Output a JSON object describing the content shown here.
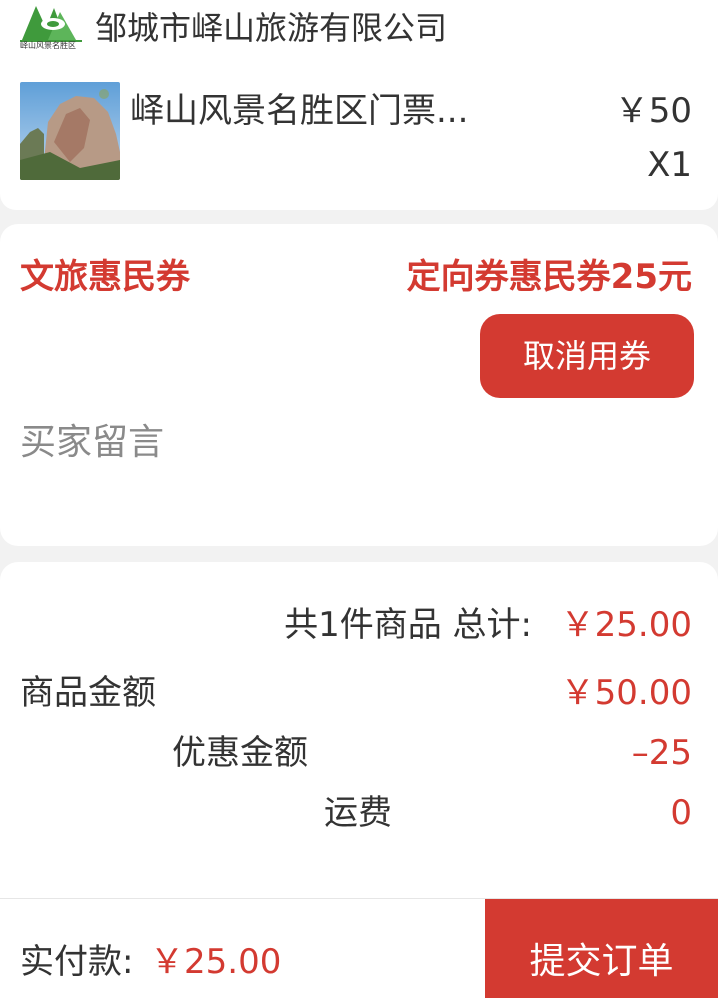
{
  "shop": {
    "name": "邹城市峄山旅游有限公司",
    "logo_caption": "峄山风景名胜区",
    "logo_icon": "mountain-logo-icon"
  },
  "product": {
    "title": "峄山风景名胜区门票...",
    "price": "￥50",
    "quantity": "X1",
    "image_icon": "scenic-rock-image"
  },
  "coupon": {
    "type": "文旅惠民券",
    "description": "定向券惠民券25元",
    "cancel_label": "取消用券"
  },
  "message": {
    "placeholder": "买家留言"
  },
  "summary": {
    "count_text": "共1件商品 总计:",
    "total": "￥25.00",
    "goods_label": "商品金额",
    "goods_value": "￥50.00",
    "discount_label": "优惠金额",
    "discount_value": "–25",
    "shipping_label": "运费",
    "shipping_value": "0"
  },
  "footer": {
    "pay_label": "实付款:",
    "pay_amount": "￥25.00",
    "submit_label": "提交订单"
  },
  "colors": {
    "accent": "#d33a31",
    "logo_green": "#3f9a3c",
    "background": "#f2f2f2"
  }
}
